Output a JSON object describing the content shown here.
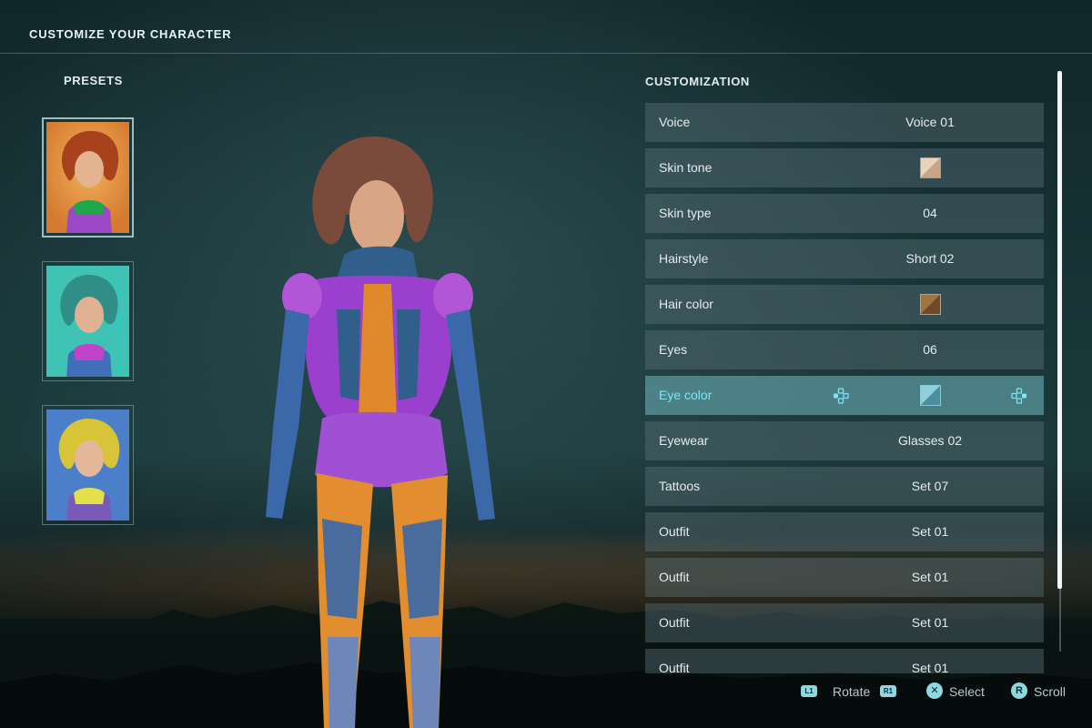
{
  "header": {
    "title": "CUSTOMIZE YOUR CHARACTER"
  },
  "presets": {
    "label": "PRESETS",
    "items": [
      {
        "hair": "copper",
        "selected": true
      },
      {
        "hair": "teal",
        "selected": false
      },
      {
        "hair": "yellow",
        "selected": false
      }
    ]
  },
  "customization": {
    "label": "CUSTOMIZATION",
    "rows": [
      {
        "label": "Voice",
        "value": "Voice 01"
      },
      {
        "label": "Skin tone",
        "swatch": [
          "#e9d3bd",
          "#c9a587"
        ]
      },
      {
        "label": "Skin type",
        "value": "04"
      },
      {
        "label": "Hairstyle",
        "value": "Short 02"
      },
      {
        "label": "Hair color",
        "swatch": [
          "#a0743e",
          "#6e4a26"
        ]
      },
      {
        "label": "Eyes",
        "value": "06"
      },
      {
        "label": "Eye color",
        "swatch": [
          "#8fd0dc",
          "#4a8fa0"
        ],
        "selected": true
      },
      {
        "label": "Eyewear",
        "value": "Glasses 02"
      },
      {
        "label": "Tattoos",
        "value": "Set 07"
      },
      {
        "label": "Outfit",
        "value": "Set 01"
      },
      {
        "label": "Outfit",
        "value": "Set 01"
      },
      {
        "label": "Outfit",
        "value": "Set 01"
      },
      {
        "label": "Outfit",
        "value": "Set 01"
      }
    ]
  },
  "footer": {
    "rotate_left_button": "L1",
    "rotate_label": "Rotate",
    "rotate_right_button": "R1",
    "select_button": "✕",
    "select_label": "Select",
    "scroll_button": "R",
    "scroll_label": "Scroll"
  },
  "colors": {
    "accent": "#6ce0ee",
    "row_bg": "#5c737a",
    "selected_row_bg": "#68aab2"
  }
}
